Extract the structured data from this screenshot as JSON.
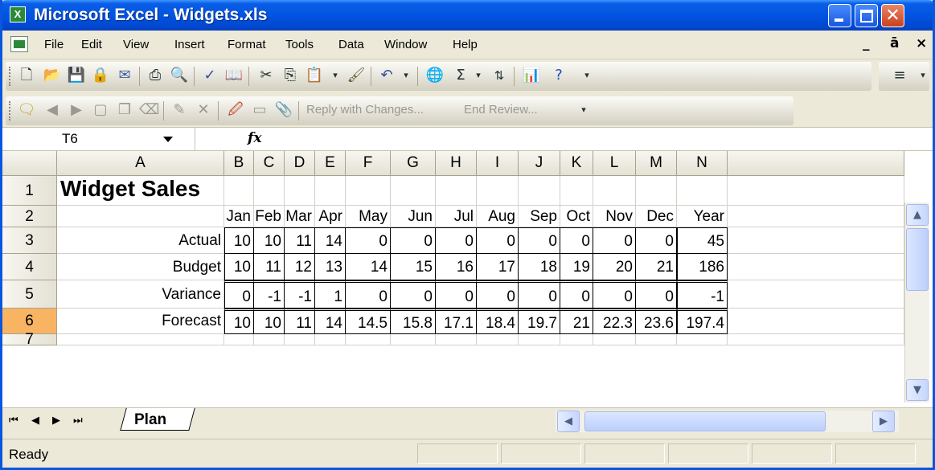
{
  "window": {
    "title": "Microsoft Excel - Widgets.xls"
  },
  "menu": [
    "File",
    "Edit",
    "View",
    "Insert",
    "Format",
    "Tools",
    "Data",
    "Window",
    "Help"
  ],
  "toolbar": {
    "standard_icons": [
      "new-icon",
      "open-icon",
      "save-icon",
      "permission-icon",
      "email-icon",
      "print-icon",
      "print-preview-icon",
      "spelling-icon",
      "research-icon",
      "cut-icon",
      "copy-icon",
      "paste-icon",
      "format-painter-icon",
      "undo-icon",
      "hyperlink-icon",
      "autosum-icon",
      "sort-ascending-icon",
      "chart-wizard-icon",
      "help-icon"
    ],
    "review_icons": [
      "new-comment-icon",
      "previous-comment-icon",
      "next-comment-icon",
      "show-comment-icon",
      "show-all-comments-icon",
      "delete-comment-icon",
      "track-changes-icon",
      "reviewing-pane-icon"
    ],
    "reply_with_changes": "Reply with Changes...",
    "end_review": "End Review..."
  },
  "formula_bar": {
    "name_box": "T6",
    "fx_label": "fx",
    "formula": ""
  },
  "sheet": {
    "columns": [
      "A",
      "B",
      "C",
      "D",
      "E",
      "F",
      "G",
      "H",
      "I",
      "J",
      "K",
      "L",
      "M",
      "N"
    ],
    "rows": [
      "1",
      "2",
      "3",
      "4",
      "5",
      "6",
      "7"
    ],
    "selected_row": "6",
    "title": "Widget Sales",
    "months": [
      "Jan",
      "Feb",
      "Mar",
      "Apr",
      "May",
      "Jun",
      "Jul",
      "Aug",
      "Sep",
      "Oct",
      "Nov",
      "Dec",
      "Year"
    ],
    "data_rows": [
      {
        "label": "Actual",
        "values": [
          "10",
          "10",
          "11",
          "14",
          "0",
          "0",
          "0",
          "0",
          "0",
          "0",
          "0",
          "0",
          "45"
        ]
      },
      {
        "label": "Budget",
        "values": [
          "10",
          "11",
          "12",
          "13",
          "14",
          "15",
          "16",
          "17",
          "18",
          "19",
          "20",
          "21",
          "186"
        ]
      },
      {
        "label": "Variance",
        "values": [
          "0",
          "-1",
          "-1",
          "1",
          "0",
          "0",
          "0",
          "0",
          "0",
          "0",
          "0",
          "0",
          "-1"
        ]
      },
      {
        "label": "Forecast",
        "values": [
          "10",
          "10",
          "11",
          "14",
          "14.5",
          "15.8",
          "17.1",
          "18.4",
          "19.7",
          "21",
          "22.3",
          "23.6",
          "197.4"
        ]
      }
    ]
  },
  "tabs": {
    "sheets": [
      "Plan"
    ]
  },
  "status": {
    "text": "Ready"
  }
}
